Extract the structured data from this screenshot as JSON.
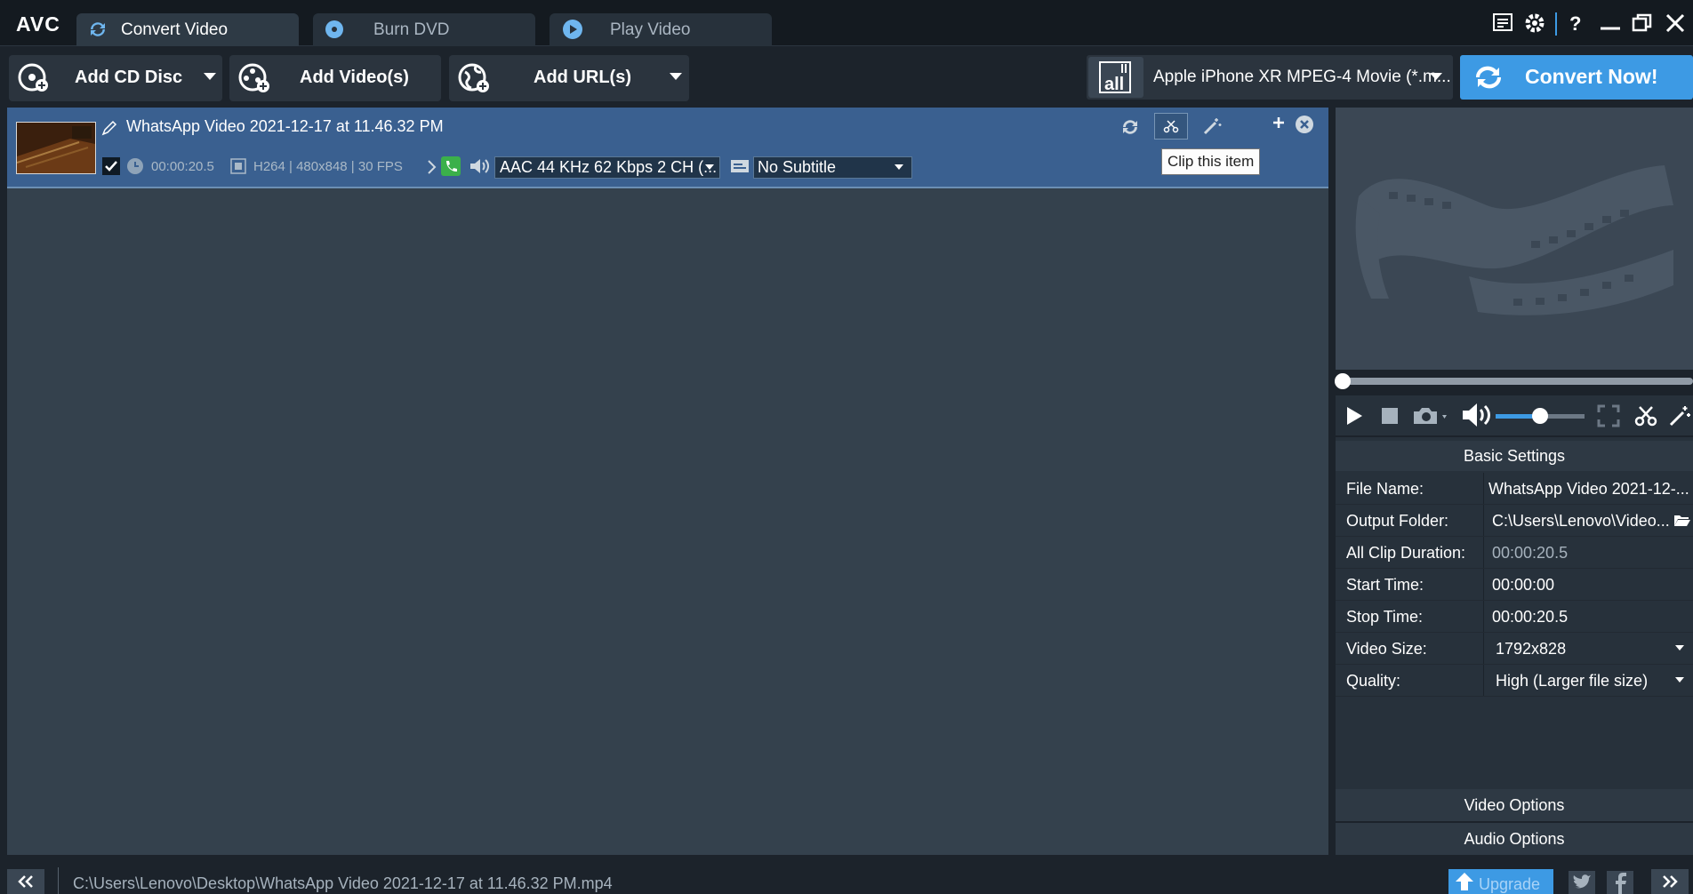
{
  "app": {
    "logo": "AVC"
  },
  "tabs": [
    {
      "label": "Convert Video",
      "active": true,
      "icon": "refresh-icon"
    },
    {
      "label": "Burn DVD",
      "active": false,
      "icon": "disc-icon"
    },
    {
      "label": "Play Video",
      "active": false,
      "icon": "play-icon"
    }
  ],
  "toolbar": {
    "add_cd": "Add CD Disc",
    "add_video": "Add Video(s)",
    "add_url": "Add URL(s)",
    "profile_badge": "all",
    "profile": "Apple iPhone XR MPEG-4 Movie (*.m...",
    "convert": "Convert Now!"
  },
  "item": {
    "title": "WhatsApp Video 2021-12-17 at 11.46.32 PM",
    "duration": "00:00:20.5",
    "video_info": "H264 | 480x848 | 30 FPS",
    "audio": "AAC 44 KHz 62 Kbps 2 CH (...",
    "subtitle": "No Subtitle",
    "checked": true
  },
  "tooltip": "Clip this item",
  "settings": {
    "header": "Basic Settings",
    "rows": [
      {
        "key": "File Name:",
        "value": "WhatsApp Video 2021-12-..."
      },
      {
        "key": "Output Folder:",
        "value": "C:\\Users\\Lenovo\\Video..."
      },
      {
        "key": "All Clip Duration:",
        "value": "00:00:20.5"
      },
      {
        "key": "Start Time:",
        "value": "00:00:00"
      },
      {
        "key": "Stop Time:",
        "value": "00:00:20.5"
      },
      {
        "key": "Video Size:",
        "value": "1792x828"
      },
      {
        "key": "Quality:",
        "value": "High (Larger file size)"
      }
    ],
    "video_options": "Video Options",
    "audio_options": "Audio Options"
  },
  "player": {
    "progress": 0.0,
    "volume": 0.5
  },
  "status": {
    "path": "C:\\Users\\Lenovo\\Desktop\\WhatsApp Video 2021-12-17 at 11.46.32 PM.mp4",
    "upgrade": "Upgrade"
  },
  "colors": {
    "accent": "#3d9ae4",
    "selection": "#3a6090",
    "background": "#34414d"
  }
}
